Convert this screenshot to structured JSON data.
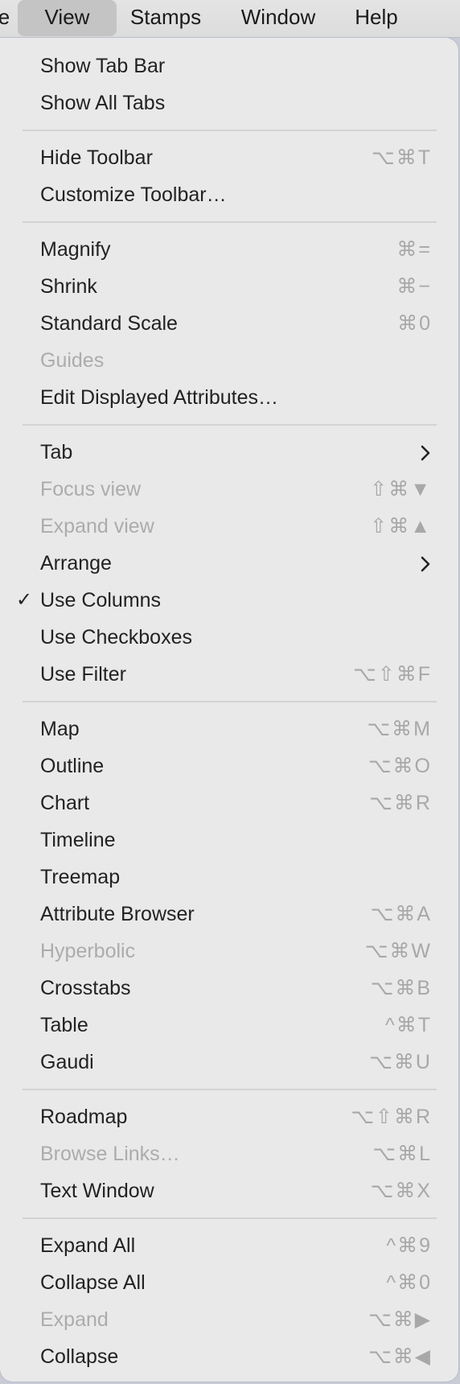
{
  "menubar": {
    "items": [
      {
        "label": "e",
        "active": false
      },
      {
        "label": "View",
        "active": true
      },
      {
        "label": "Stamps",
        "active": false
      },
      {
        "label": "Window",
        "active": false
      },
      {
        "label": "Help",
        "active": false
      }
    ]
  },
  "menu": {
    "title": "View",
    "groups": [
      [
        {
          "label": "Show Tab Bar",
          "shortcut": "",
          "enabled": true
        },
        {
          "label": "Show All Tabs",
          "shortcut": "",
          "enabled": true
        }
      ],
      [
        {
          "label": "Hide Toolbar",
          "shortcut": "⌥⌘T",
          "enabled": true
        },
        {
          "label": "Customize Toolbar…",
          "shortcut": "",
          "enabled": true
        }
      ],
      [
        {
          "label": "Magnify",
          "shortcut": "⌘=",
          "enabled": true
        },
        {
          "label": "Shrink",
          "shortcut": "⌘−",
          "enabled": true
        },
        {
          "label": "Standard Scale",
          "shortcut": "⌘0",
          "enabled": true
        },
        {
          "label": "Guides",
          "shortcut": "",
          "enabled": false
        },
        {
          "label": "Edit Displayed Attributes…",
          "shortcut": "",
          "enabled": true
        }
      ],
      [
        {
          "label": "Tab",
          "shortcut": "",
          "enabled": true,
          "submenu": true
        },
        {
          "label": "Focus view",
          "shortcut": "⇧⌘▼",
          "enabled": false
        },
        {
          "label": "Expand view",
          "shortcut": "⇧⌘▲",
          "enabled": false
        },
        {
          "label": "Arrange",
          "shortcut": "",
          "enabled": true,
          "submenu": true
        },
        {
          "label": "Use Columns",
          "shortcut": "",
          "enabled": true,
          "checked": true
        },
        {
          "label": "Use Checkboxes",
          "shortcut": "",
          "enabled": true
        },
        {
          "label": "Use Filter",
          "shortcut": "⌥⇧⌘F",
          "enabled": true
        }
      ],
      [
        {
          "label": "Map",
          "shortcut": "⌥⌘M",
          "enabled": true
        },
        {
          "label": "Outline",
          "shortcut": "⌥⌘O",
          "enabled": true
        },
        {
          "label": "Chart",
          "shortcut": "⌥⌘R",
          "enabled": true
        },
        {
          "label": "Timeline",
          "shortcut": "",
          "enabled": true
        },
        {
          "label": "Treemap",
          "shortcut": "",
          "enabled": true
        },
        {
          "label": "Attribute Browser",
          "shortcut": "⌥⌘A",
          "enabled": true
        },
        {
          "label": "Hyperbolic",
          "shortcut": "⌥⌘W",
          "enabled": false
        },
        {
          "label": "Crosstabs",
          "shortcut": "⌥⌘B",
          "enabled": true
        },
        {
          "label": "Table",
          "shortcut": "^⌘T",
          "enabled": true
        },
        {
          "label": "Gaudi",
          "shortcut": "⌥⌘U",
          "enabled": true
        }
      ],
      [
        {
          "label": "Roadmap",
          "shortcut": "⌥⇧⌘R",
          "enabled": true
        },
        {
          "label": "Browse Links…",
          "shortcut": "⌥⌘L",
          "enabled": false
        },
        {
          "label": "Text Window",
          "shortcut": "⌥⌘X",
          "enabled": true
        }
      ],
      [
        {
          "label": "Expand All",
          "shortcut": "^⌘9",
          "enabled": true
        },
        {
          "label": "Collapse All",
          "shortcut": "^⌘0",
          "enabled": true
        },
        {
          "label": "Expand",
          "shortcut": "⌥⌘▶",
          "enabled": false
        },
        {
          "label": "Collapse",
          "shortcut": "⌥⌘◀",
          "enabled": true
        }
      ]
    ],
    "checkmark_glyph": "✓"
  }
}
